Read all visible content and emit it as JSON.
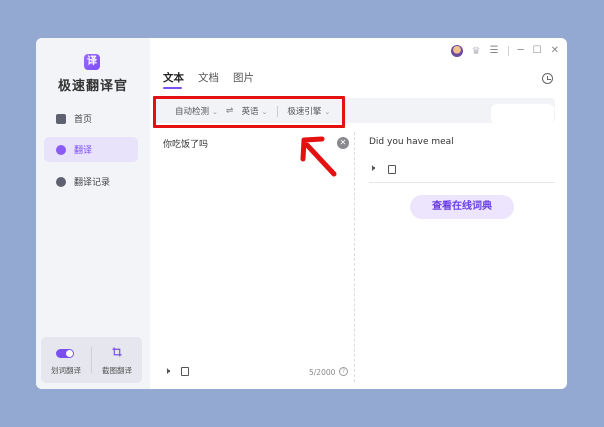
{
  "app": {
    "title": "极速翻译官",
    "logo_char": "译"
  },
  "sidebar": {
    "items": [
      {
        "label": "首页",
        "icon": "home-icon",
        "active": false
      },
      {
        "label": "翻译",
        "icon": "translate-icon",
        "active": true
      },
      {
        "label": "翻译记录",
        "icon": "history-icon",
        "active": false
      }
    ],
    "tools": {
      "word_translate": "划词翻译",
      "screenshot_translate": "截图翻译"
    }
  },
  "tabs": [
    {
      "label": "文本",
      "active": true
    },
    {
      "label": "文档",
      "active": false
    },
    {
      "label": "图片",
      "active": false
    }
  ],
  "language_bar": {
    "source_lang": "自动检测",
    "target_lang": "英语",
    "engine": "极速引擎",
    "swap_glyph": "⇌"
  },
  "source": {
    "text": "你吃饭了吗",
    "char_count": "5/2000"
  },
  "target": {
    "text": "Did you have meal",
    "dict_button": "查看在线词典"
  },
  "colors": {
    "accent": "#7a4ff0",
    "highlight_box": "#e51010",
    "background": "#93a9d1"
  }
}
